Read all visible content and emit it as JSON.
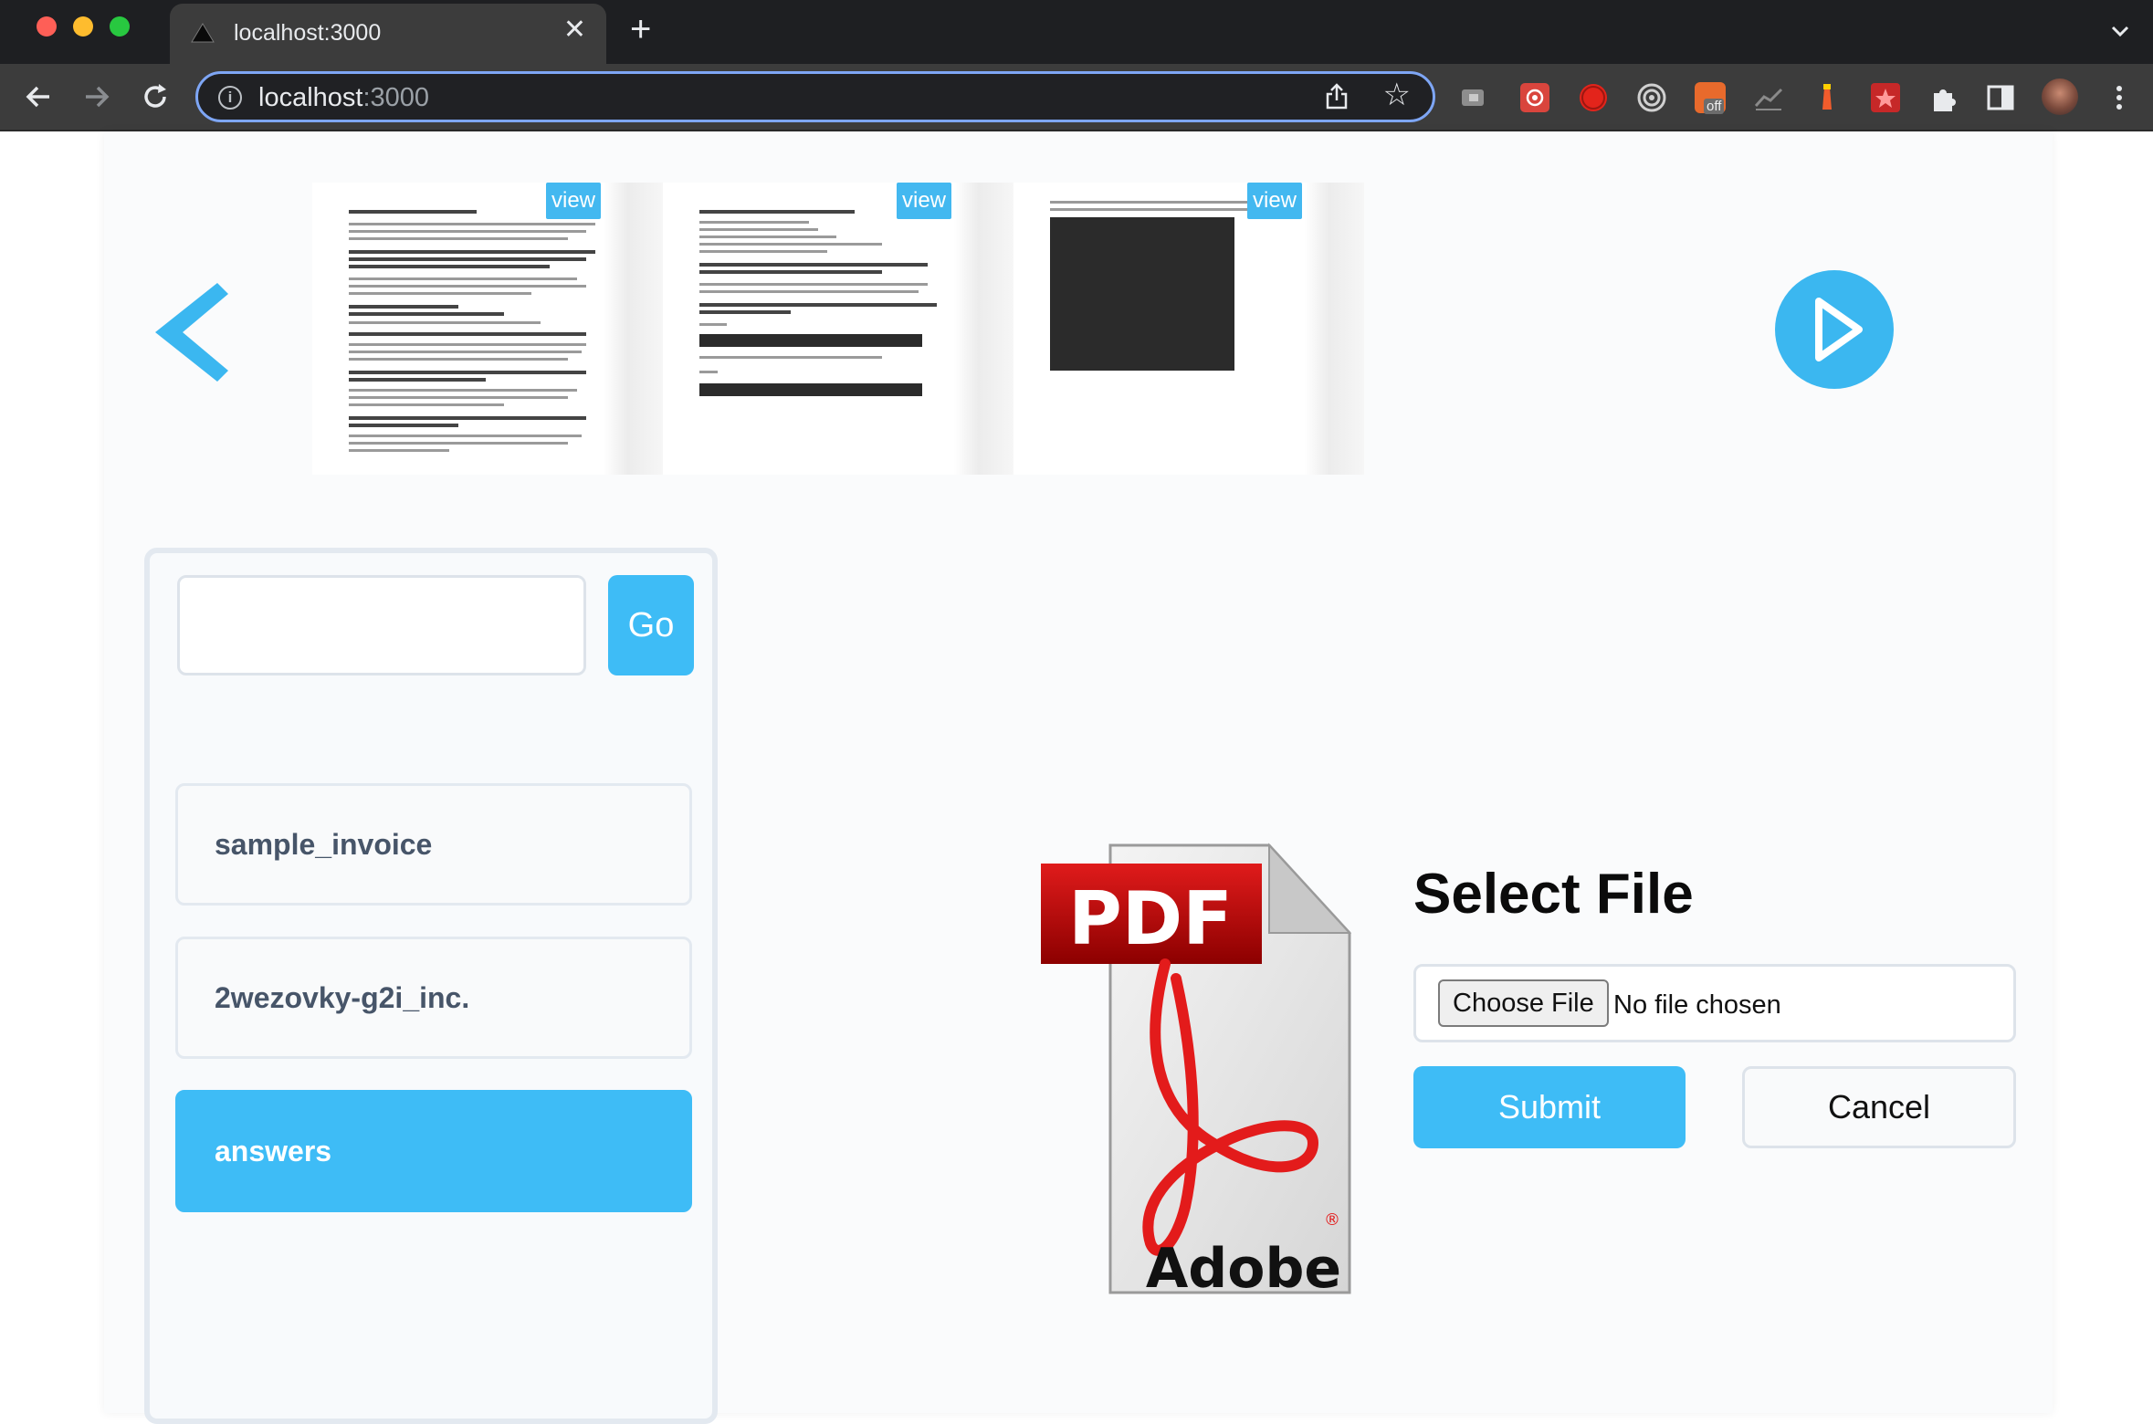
{
  "browser": {
    "tab_title": "localhost:3000",
    "url_host": "localhost",
    "url_port": ":3000",
    "extensions": [
      "camera-icon",
      "bug-icon",
      "record-icon",
      "target-icon",
      "off-badge-icon",
      "chart-icon",
      "lighthouse-icon",
      "star-square-icon",
      "puzzle-icon",
      "sidepanel-icon",
      "avatar",
      "menu-icon"
    ],
    "extension_badge": "off"
  },
  "carousel": {
    "view_label": "view",
    "thumbnails": [
      {
        "name": "thumb-1"
      },
      {
        "name": "thumb-2"
      },
      {
        "name": "thumb-3"
      }
    ]
  },
  "sidebar": {
    "search": {
      "value": "",
      "placeholder": ""
    },
    "go_label": "Go",
    "files": [
      {
        "label": "sample_invoice",
        "active": false
      },
      {
        "label": "2wezovky-g2i_inc.",
        "active": true
      },
      {
        "label": "answers",
        "active": true
      }
    ]
  },
  "upload": {
    "title": "Select File",
    "choose_label": "Choose File",
    "no_file_label": "No file chosen",
    "submit_label": "Submit",
    "cancel_label": "Cancel",
    "pdf_icon_text": "PDF",
    "pdf_brand_text": "Adobe"
  },
  "colors": {
    "accent": "#3ebcf6",
    "chrome_dark": "#1e1f22",
    "chrome_toolbar": "#3c3c3c"
  }
}
